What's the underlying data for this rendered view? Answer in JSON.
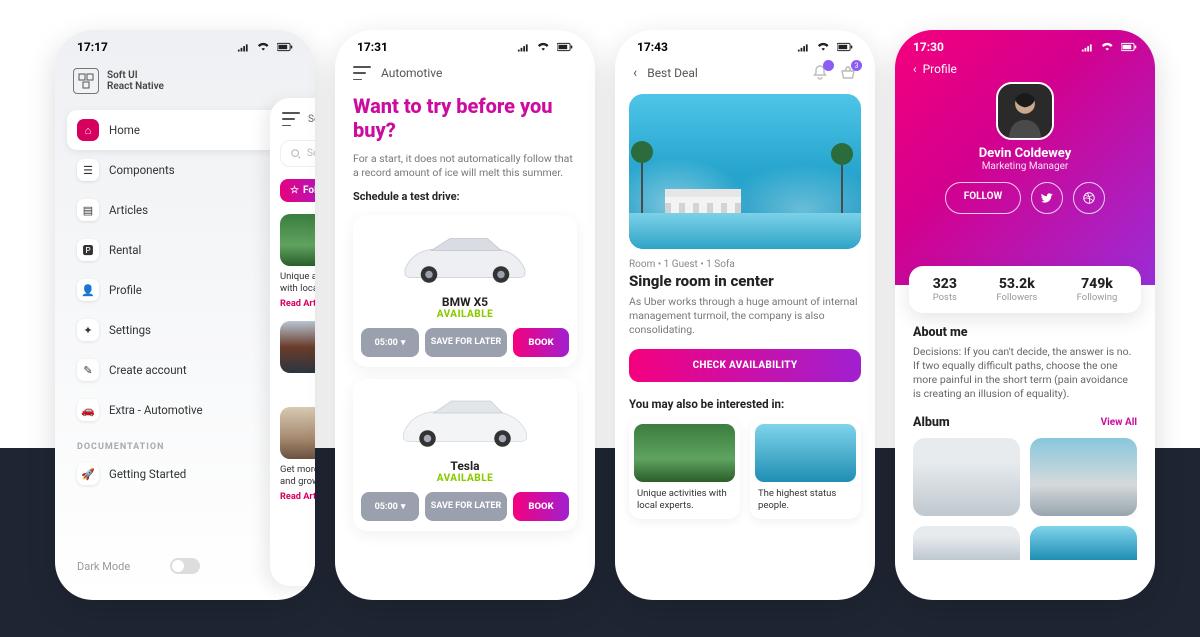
{
  "phone1": {
    "time": "17:17",
    "brand_line1": "Soft UI",
    "brand_line2": "React Native",
    "nav": {
      "home": "Home",
      "components": "Components",
      "articles": "Articles",
      "rental": "Rental",
      "profile": "Profile",
      "settings": "Settings",
      "create": "Create account",
      "extra": "Extra - Automotive",
      "section_docs": "DOCUMENTATION",
      "getting_started": "Getting Started"
    },
    "dark_mode_label": "Dark Mode",
    "back": {
      "header": "Soft UI",
      "search_placeholder": "Search",
      "follow_btn": "Follo",
      "card1_caption": "Unique activities with local experts.",
      "card1_link": "Read Article  ›",
      "card2_caption": "Get more followers and grow.",
      "card2_link": "Read Article  ›"
    }
  },
  "phone2": {
    "time": "17:31",
    "header": "Automotive",
    "headline": "Want to try before you buy?",
    "desc": "For a start, it does not automatically follow that a record amount of ice will melt this summer.",
    "schedule_label": "Schedule a test drive:",
    "cars": [
      {
        "name": "BMW X5",
        "status": "AVAILABLE",
        "time": "05:00",
        "save": "SAVE FOR LATER",
        "book": "BOOK"
      },
      {
        "name": "Tesla",
        "status": "AVAILABLE",
        "time": "05:00",
        "save": "SAVE FOR LATER",
        "book": "BOOK"
      }
    ]
  },
  "phone3": {
    "time": "17:43",
    "header": "Best Deal",
    "badge_count": "3",
    "meta": "Room • 1 Guest • 1 Sofa",
    "title": "Single room in center",
    "desc": "As Uber works through a huge amount of internal management turmoil, the company is also consolidating.",
    "check_btn": "CHECK AVAILABILITY",
    "interest_label": "You may also be interested in:",
    "card1": "Unique activities with local experts.",
    "card2": "The highest status people."
  },
  "phone4": {
    "time": "17:30",
    "back_label": "Profile",
    "name": "Devin Coldewey",
    "role": "Marketing Manager",
    "follow_btn": "FOLLOW",
    "stats": [
      {
        "n": "323",
        "l": "Posts"
      },
      {
        "n": "53.2k",
        "l": "Followers"
      },
      {
        "n": "749k",
        "l": "Following"
      }
    ],
    "about_h": "About me",
    "about": "Decisions: If you can't decide, the answer is no. If two equally difficult paths, choose the one more painful in the short term (pain avoidance is creating an illusion of equality).",
    "album_h": "Album",
    "viewall": "View All"
  }
}
